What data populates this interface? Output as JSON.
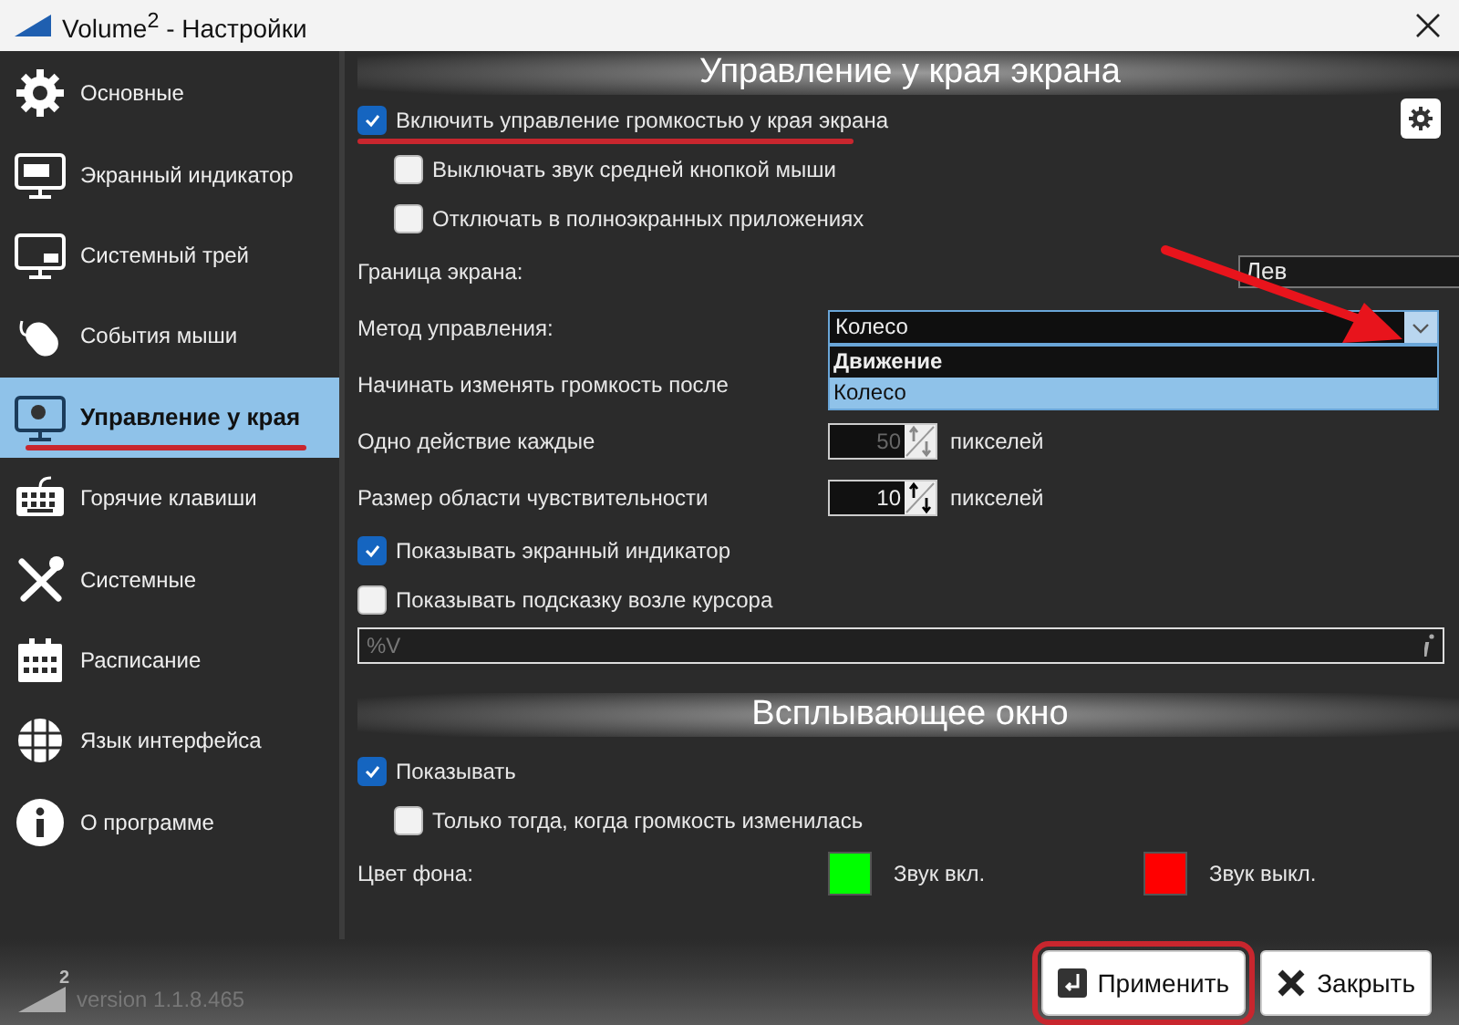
{
  "window": {
    "title": "Volume$^{2}$ - Настройки"
  },
  "sidebar": {
    "items": [
      {
        "label": "Основные",
        "selected": false,
        "annotated": false
      },
      {
        "label": "Экранный индикатор",
        "selected": false,
        "annotated": false
      },
      {
        "label": "Системный трей",
        "selected": false,
        "annotated": false
      },
      {
        "label": "События мыши",
        "selected": false,
        "annotated": false
      },
      {
        "label": "Управление у края",
        "selected": true,
        "annotated": true
      },
      {
        "label": "Горячие клавиши",
        "selected": false,
        "annotated": false
      },
      {
        "label": "Системные",
        "selected": false,
        "annotated": false
      },
      {
        "label": "Расписание",
        "selected": false,
        "annotated": false
      },
      {
        "label": "Язык интерфейса",
        "selected": false,
        "annotated": false
      },
      {
        "label": "О программе",
        "selected": false,
        "annotated": false
      }
    ]
  },
  "edge_section": {
    "title": "Управление у края экрана",
    "enable": {
      "label": "Включить управление громкостью у края экрана",
      "checked": true,
      "annotated": true
    },
    "options": [
      {
        "label": "Выключать звук средней кнопкой мыши",
        "checked": false
      },
      {
        "label": "Отключать в полноэкранных приложениях",
        "checked": false
      }
    ],
    "screen_edge": {
      "label": "Граница экрана:",
      "value": "Лев"
    },
    "method": {
      "label": "Метод управления:",
      "value": "Колесо",
      "expanded": true,
      "annotated": true,
      "options": [
        {
          "label": "Движение",
          "selected": false,
          "emphasized": true
        },
        {
          "label": "Колесо",
          "selected": true,
          "emphasized": false
        }
      ]
    },
    "start_after": {
      "label": "Начинать изменять громкость после"
    },
    "spinners": [
      {
        "label": "Одно действие каждые",
        "value": "50",
        "disabled": true,
        "unit": "пикселей"
      },
      {
        "label": "Размер области чувствительности",
        "value": "10",
        "disabled": false,
        "unit": "пикселей"
      }
    ],
    "show_options": [
      {
        "label": "Показывать экранный индикатор",
        "checked": true
      },
      {
        "label": "Показывать подсказку возле курсора",
        "checked": false
      }
    ],
    "tooltip_format": {
      "placeholder": "%V",
      "disabled": true
    }
  },
  "popup_section": {
    "title": "Всплывающее окно",
    "show": {
      "label": "Показывать",
      "checked": true
    },
    "only_changed": {
      "label": "Только тогда, когда громкость изменилась",
      "checked": false
    },
    "background": {
      "label": "Цвет фона:",
      "swatches": [
        {
          "color": "#00ff00",
          "label": "Звук вкл."
        },
        {
          "color": "#ff0000",
          "label": "Звук выкл."
        }
      ]
    }
  },
  "version": {
    "logo_mark": "2",
    "text": "version 1.1.8.465"
  },
  "buttons": [
    {
      "label": "Применить",
      "kind": "apply",
      "annotated": true
    },
    {
      "label": "Закрыть",
      "kind": "close",
      "annotated": false
    }
  ]
}
